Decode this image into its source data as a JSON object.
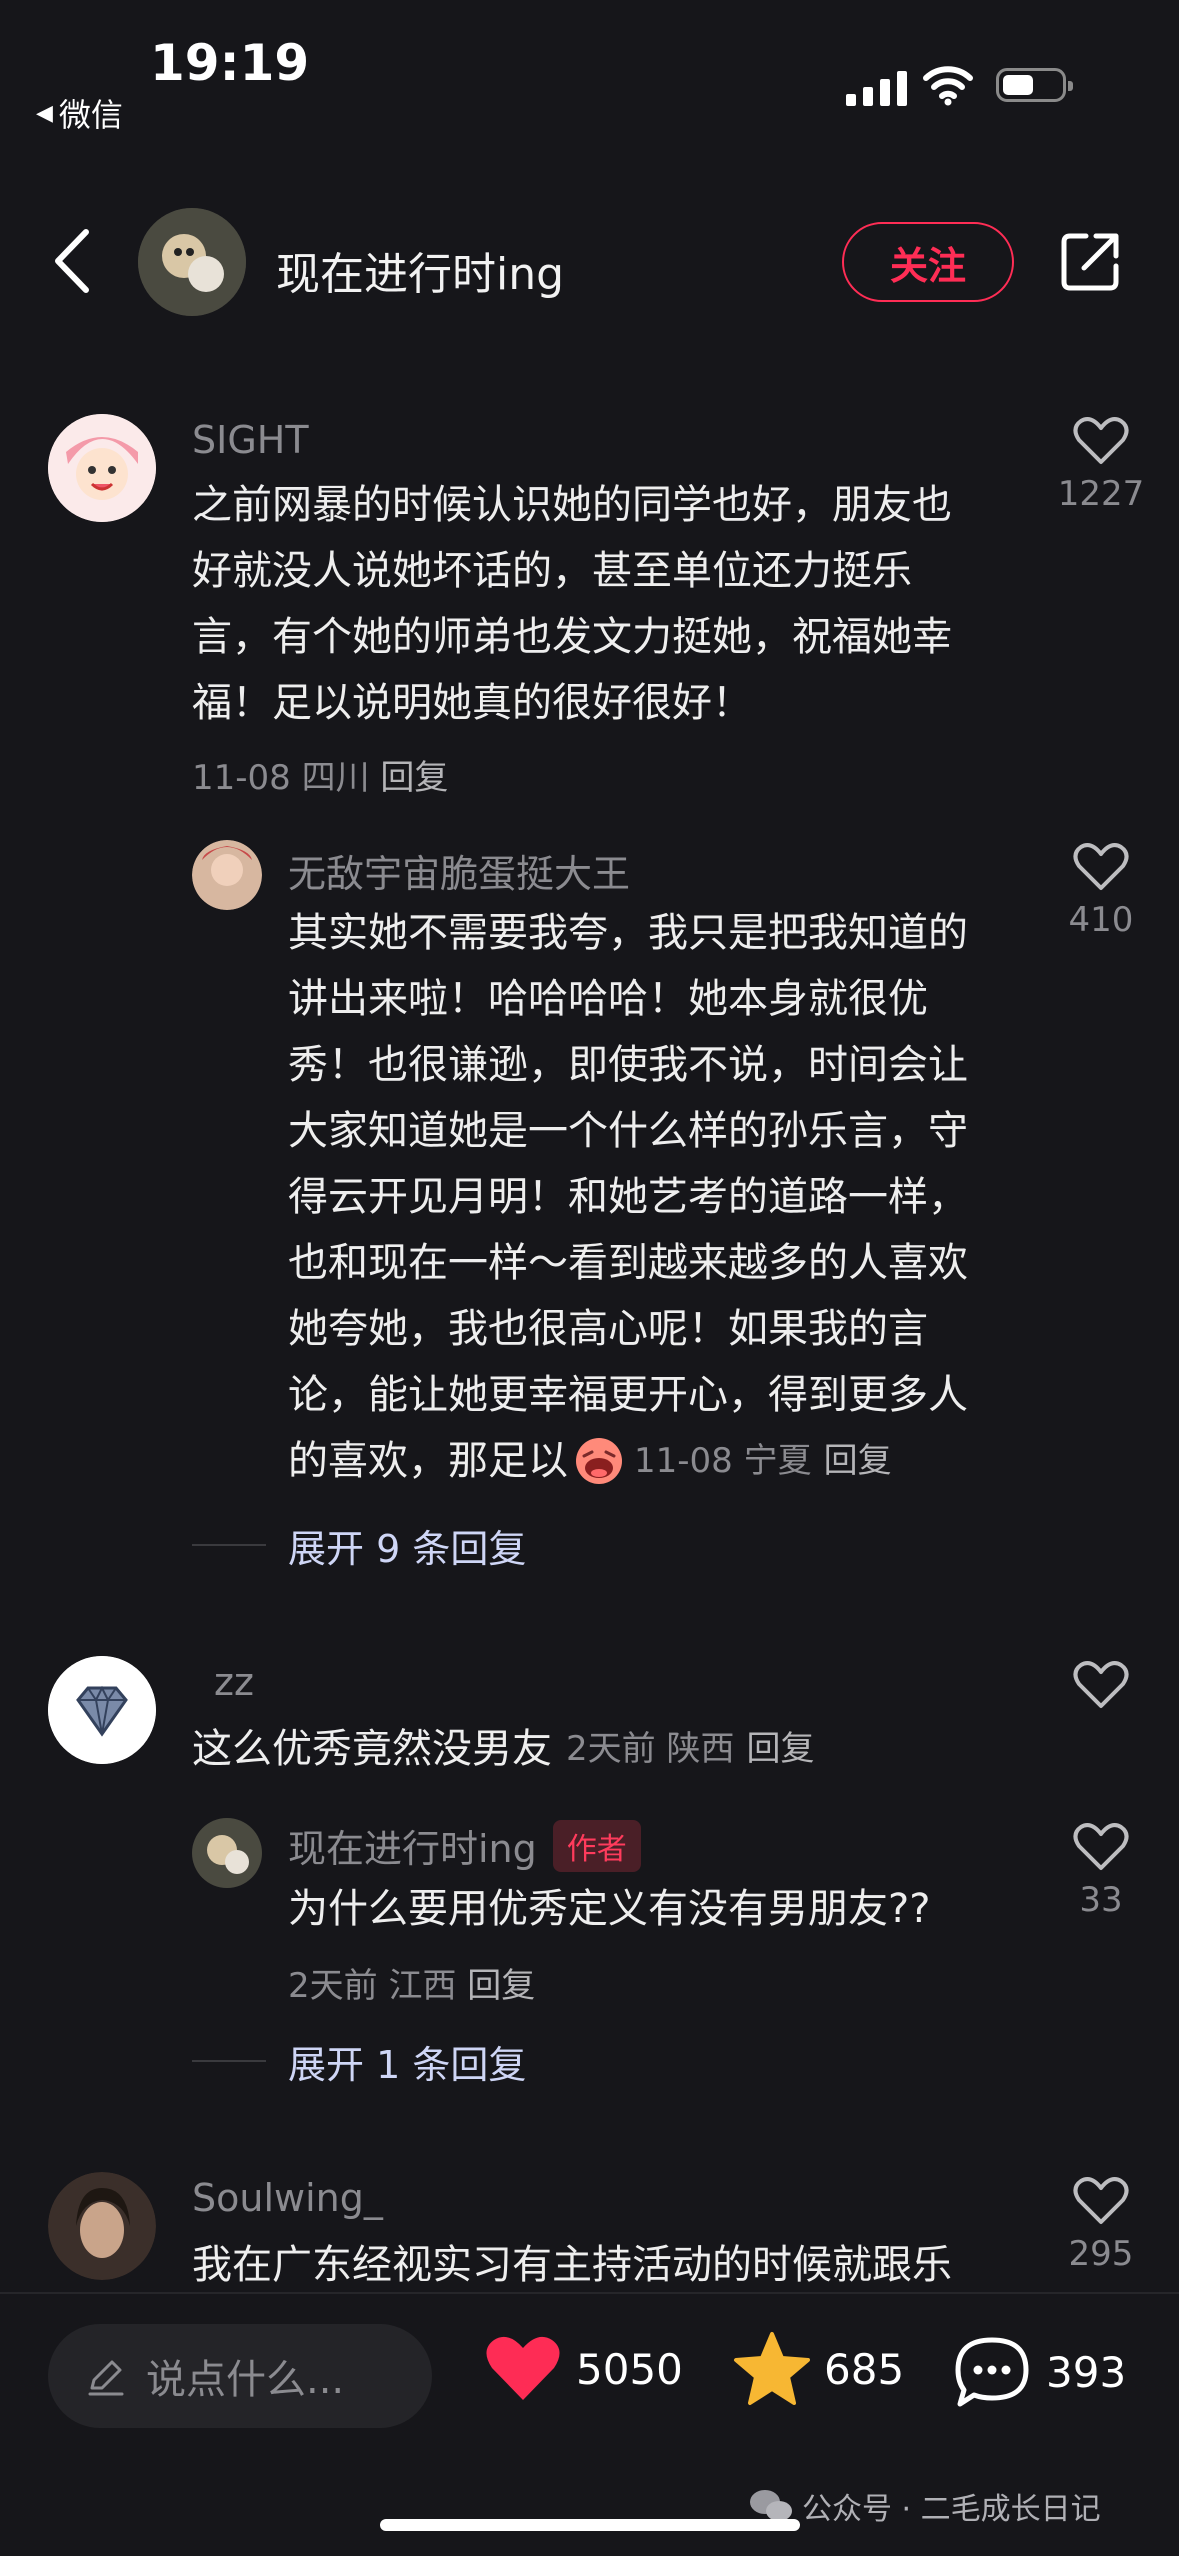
{
  "status_bar": {
    "time": "19:19",
    "back_app": "微信"
  },
  "header": {
    "author_name": "现在进行时ing",
    "follow_label": "关注"
  },
  "comments": [
    {
      "user": "SIGHT",
      "text": [
        "之前网暴的时候认识她的同学也好，朋友也",
        "好就没人说她坏话的，甚至单位还力挺乐",
        "言，有个她的师弟也发文力挺她，祝福她幸",
        "福！足以说明她真的很好很好！"
      ],
      "date_loc": "11-08 四川",
      "reply": "回复",
      "likes": "1227"
    },
    {
      "user": "无敌宇宙脆蛋挺大王",
      "text": [
        "其实她不需要我夸，我只是把我知道的",
        "讲出来啦！哈哈哈哈！她本身就很优",
        "秀！也很谦逊，即使我不说，时间会让",
        "大家知道她是一个什么样的孙乐言，守",
        "得云开见月明！和她艺考的道路一样，",
        "也和现在一样～看到越来越多的人喜欢",
        "她夸她，我也很高心呢！如果我的言",
        "论，能让她更幸福更开心，得到更多人"
      ],
      "last_line": "的喜欢，那足以",
      "date_loc": "11-08 宁夏",
      "reply": "回复",
      "likes": "410",
      "expand": "展开 9 条回复"
    },
    {
      "user": "zz",
      "text": "这么优秀竟然没男友",
      "date_loc": "2天前 陕西",
      "reply": "回复"
    },
    {
      "user": "现在进行时ing",
      "author_tag": "作者",
      "text": "为什么要用优秀定义有没有男朋友??",
      "date_loc": "2天前 江西",
      "reply": "回复",
      "likes": "33",
      "expand": "展开 1 条回复"
    },
    {
      "user": "Soulwing_",
      "text": "我在广东经视实习有主持活动的时候就跟乐",
      "likes": "295"
    }
  ],
  "bottom_bar": {
    "input_placeholder": "说点什么...",
    "likes": "5050",
    "favorites": "685",
    "comments": "393"
  },
  "watermark": "公众号 · 二毛成长日记",
  "colors": {
    "background": "#16161a",
    "accent": "#ff2d55",
    "like_red": "#fe2c55",
    "star_yellow": "#f7b733"
  }
}
